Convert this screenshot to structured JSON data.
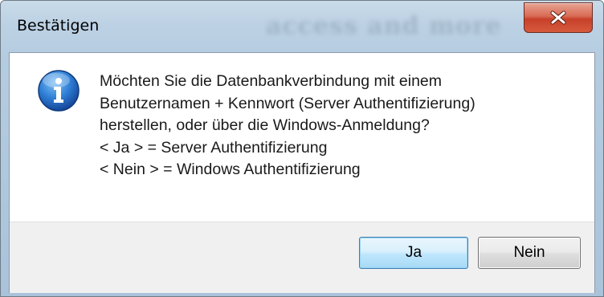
{
  "window": {
    "title": "Bestätigen"
  },
  "dialog": {
    "icon": "info-icon",
    "message_lines": [
      "Möchten Sie die Datenbankverbindung mit einem",
      "Benutzernamen + Kennwort (Server Authentifizierung)",
      "herstellen, oder über die Windows-Anmeldung?",
      "< Ja > = Server Authentifizierung",
      "< Nein > = Windows Authentifizierung"
    ]
  },
  "buttons": {
    "yes_label": "Ja",
    "no_label": "Nein"
  },
  "colors": {
    "title_bar": "#bcd1e4",
    "close_button": "#c7402a",
    "icon_blue": "#1f66b8",
    "default_button_border": "#3c7fb1",
    "footer": "#f0f0f0"
  }
}
